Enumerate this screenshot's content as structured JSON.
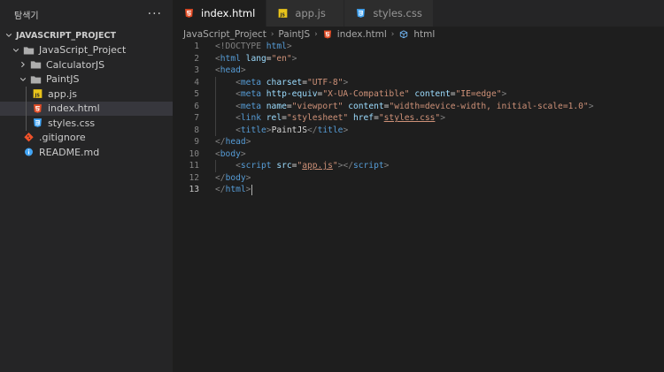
{
  "sidebar": {
    "title": "탐색기",
    "more": "···",
    "root": "JAVASCRIPT_PROJECT",
    "tree": [
      {
        "label": "JavaScript_Project",
        "kind": "folder",
        "level": 1,
        "open": true
      },
      {
        "label": "CalculatorJS",
        "kind": "folder",
        "level": 2,
        "open": false
      },
      {
        "label": "PaintJS",
        "kind": "folder",
        "level": 2,
        "open": true
      },
      {
        "label": "app.js",
        "kind": "js",
        "level": 3
      },
      {
        "label": "index.html",
        "kind": "html",
        "level": 3,
        "selected": true
      },
      {
        "label": "styles.css",
        "kind": "css",
        "level": 3
      },
      {
        "label": ".gitignore",
        "kind": "git",
        "level": 1
      },
      {
        "label": "README.md",
        "kind": "md",
        "level": 1
      }
    ]
  },
  "tabs": [
    {
      "label": "index.html",
      "kind": "html",
      "active": true
    },
    {
      "label": "app.js",
      "kind": "js",
      "active": false
    },
    {
      "label": "styles.css",
      "kind": "css",
      "active": false
    }
  ],
  "breadcrumb": {
    "items": [
      "JavaScript_Project",
      "PaintJS",
      "index.html",
      "html"
    ]
  },
  "editor": {
    "current_line": 13,
    "lines": [
      [
        [
          "<!DOCTYPE ",
          "t-punct"
        ],
        [
          "html",
          "t-tag"
        ],
        [
          ">",
          "t-punct"
        ]
      ],
      [
        [
          "<",
          "t-punct"
        ],
        [
          "html",
          "t-tag"
        ],
        [
          " ",
          "t-text"
        ],
        [
          "lang",
          "t-attr"
        ],
        [
          "=",
          "t-text"
        ],
        [
          "\"en\"",
          "t-str"
        ],
        [
          ">",
          "t-punct"
        ]
      ],
      [
        [
          "<",
          "t-punct"
        ],
        [
          "head",
          "t-tag"
        ],
        [
          ">",
          "t-punct"
        ]
      ],
      [
        [
          "    ",
          "t-text"
        ],
        [
          "<",
          "t-punct"
        ],
        [
          "meta",
          "t-tag"
        ],
        [
          " ",
          "t-text"
        ],
        [
          "charset",
          "t-attr"
        ],
        [
          "=",
          "t-text"
        ],
        [
          "\"UTF-8\"",
          "t-str"
        ],
        [
          ">",
          "t-punct"
        ]
      ],
      [
        [
          "    ",
          "t-text"
        ],
        [
          "<",
          "t-punct"
        ],
        [
          "meta",
          "t-tag"
        ],
        [
          " ",
          "t-text"
        ],
        [
          "http-equiv",
          "t-attr"
        ],
        [
          "=",
          "t-text"
        ],
        [
          "\"X-UA-Compatible\"",
          "t-str"
        ],
        [
          " ",
          "t-text"
        ],
        [
          "content",
          "t-attr"
        ],
        [
          "=",
          "t-text"
        ],
        [
          "\"IE=edge\"",
          "t-str"
        ],
        [
          ">",
          "t-punct"
        ]
      ],
      [
        [
          "    ",
          "t-text"
        ],
        [
          "<",
          "t-punct"
        ],
        [
          "meta",
          "t-tag"
        ],
        [
          " ",
          "t-text"
        ],
        [
          "name",
          "t-attr"
        ],
        [
          "=",
          "t-text"
        ],
        [
          "\"viewport\"",
          "t-str"
        ],
        [
          " ",
          "t-text"
        ],
        [
          "content",
          "t-attr"
        ],
        [
          "=",
          "t-text"
        ],
        [
          "\"width=device-width, initial-scale=1.0\"",
          "t-str"
        ],
        [
          ">",
          "t-punct"
        ]
      ],
      [
        [
          "    ",
          "t-text"
        ],
        [
          "<",
          "t-punct"
        ],
        [
          "link",
          "t-tag"
        ],
        [
          " ",
          "t-text"
        ],
        [
          "rel",
          "t-attr"
        ],
        [
          "=",
          "t-text"
        ],
        [
          "\"stylesheet\"",
          "t-str"
        ],
        [
          " ",
          "t-text"
        ],
        [
          "href",
          "t-attr"
        ],
        [
          "=",
          "t-text"
        ],
        [
          "\"",
          "t-str"
        ],
        [
          "styles.css",
          "t-str t-link"
        ],
        [
          "\"",
          "t-str"
        ],
        [
          ">",
          "t-punct"
        ]
      ],
      [
        [
          "    ",
          "t-text"
        ],
        [
          "<",
          "t-punct"
        ],
        [
          "title",
          "t-tag"
        ],
        [
          ">",
          "t-punct"
        ],
        [
          "PaintJS",
          "t-text"
        ],
        [
          "</",
          "t-punct"
        ],
        [
          "title",
          "t-tag"
        ],
        [
          ">",
          "t-punct"
        ]
      ],
      [
        [
          "</",
          "t-punct"
        ],
        [
          "head",
          "t-tag"
        ],
        [
          ">",
          "t-punct"
        ]
      ],
      [
        [
          "<",
          "t-punct"
        ],
        [
          "body",
          "t-tag"
        ],
        [
          ">",
          "t-punct"
        ]
      ],
      [
        [
          "    ",
          "t-text"
        ],
        [
          "<",
          "t-punct"
        ],
        [
          "script",
          "t-tag"
        ],
        [
          " ",
          "t-text"
        ],
        [
          "src",
          "t-attr"
        ],
        [
          "=",
          "t-text"
        ],
        [
          "\"",
          "t-str"
        ],
        [
          "app.js",
          "t-str t-link"
        ],
        [
          "\"",
          "t-str"
        ],
        [
          "></",
          "t-punct"
        ],
        [
          "script",
          "t-tag"
        ],
        [
          ">",
          "t-punct"
        ]
      ],
      [
        [
          "</",
          "t-punct"
        ],
        [
          "body",
          "t-tag"
        ],
        [
          ">",
          "t-punct"
        ]
      ],
      [
        [
          "</",
          "t-punct"
        ],
        [
          "html",
          "t-tag"
        ],
        [
          ">",
          "t-punct"
        ]
      ]
    ]
  }
}
